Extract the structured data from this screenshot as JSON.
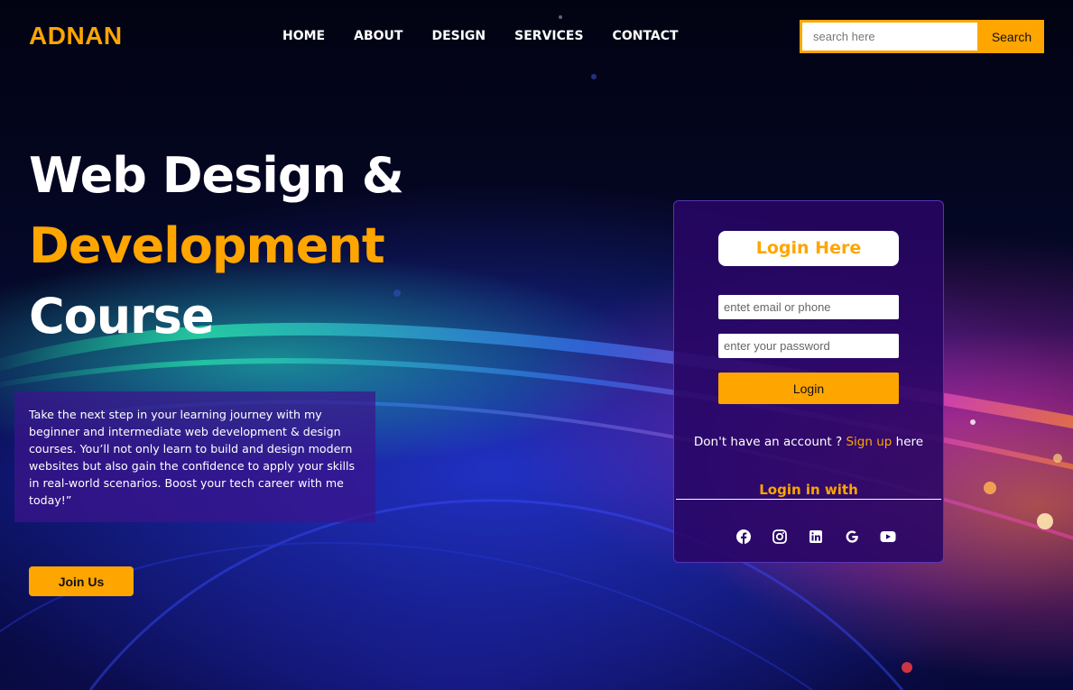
{
  "brand": {
    "logo": "ADNAN"
  },
  "nav": {
    "items": [
      {
        "label": "HOME"
      },
      {
        "label": "ABOUT"
      },
      {
        "label": "DESIGN"
      },
      {
        "label": "SERVICES"
      },
      {
        "label": "CONTACT"
      }
    ]
  },
  "search": {
    "placeholder": "search here",
    "button_label": "Search"
  },
  "hero": {
    "line1": "Web Design &",
    "line2": "Development",
    "line3": "Course",
    "description": "Take the next step in your learning journey with my beginner and intermediate web development & design courses. You’ll not only learn to build and design modern websites but also gain the confidence to apply your skills in real-world scenarios. Boost your tech career with me today!”",
    "join_label": "Join Us"
  },
  "login": {
    "title": "Login Here",
    "email_placeholder": "entet email or phone",
    "password_placeholder": "enter your password",
    "button_label": "Login",
    "signup_prefix": "Don't have an account ?",
    "signup_link": "Sign up",
    "signup_suffix": "here",
    "login_with": "Login in with",
    "socials": [
      "facebook-icon",
      "instagram-icon",
      "linkedin-icon",
      "google-icon",
      "youtube-icon"
    ]
  },
  "colors": {
    "accent": "#ffa500",
    "card": "#28066e",
    "text": "#ffffff"
  }
}
